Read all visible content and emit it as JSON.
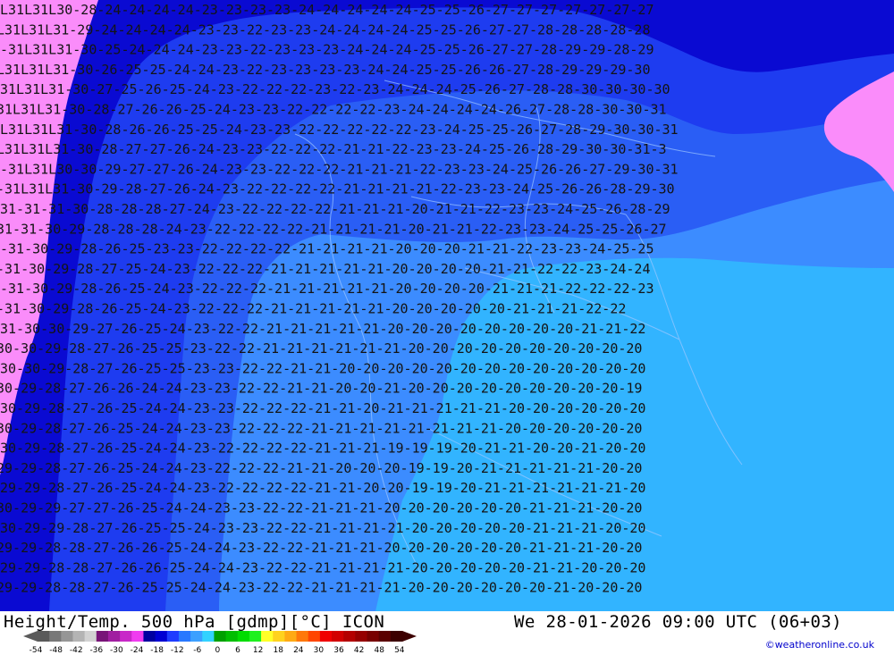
{
  "footer": {
    "title": "Height/Temp. 500 hPa [gdmp][°C] ICON",
    "valid": "We 28-01-2026 09:00 UTC (06+03)",
    "credit": "©weatheronline.co.uk"
  },
  "legend": {
    "labels": [
      "-54",
      "-48",
      "-42",
      "-36",
      "-30",
      "-24",
      "-18",
      "-12",
      "-6",
      "0",
      "6",
      "12",
      "18",
      "24",
      "30",
      "36",
      "42",
      "48",
      "54"
    ],
    "colors": [
      "#5a5a5a",
      "#787878",
      "#969696",
      "#b4b4b4",
      "#d2d2d2",
      "#781478",
      "#a01ea0",
      "#c828c8",
      "#f03cf0",
      "#0000a0",
      "#0000d2",
      "#1e3cff",
      "#2878ff",
      "#3ca0ff",
      "#32d2ff",
      "#00a000",
      "#00be00",
      "#00dc00",
      "#1ef01e",
      "#ffff28",
      "#ffd21e",
      "#ffaa14",
      "#ff780a",
      "#ff4600",
      "#f00000",
      "#d20000",
      "#b40000",
      "#960000",
      "#780000",
      "#5a0000",
      "#3c0000"
    ]
  },
  "map": {
    "zone_colors": {
      "magenta": "#fa8cfa",
      "dark_blue": "#0a0ad2",
      "mid_blue": "#1e3cf0",
      "blue": "#2a5ef5",
      "light_blue": "#3c8cff",
      "cyan_blue": "#32b4ff"
    },
    "label_rows": [
      "L31L31L30-28-24-24-24-24-23-23-23-23-24-24-24-24-24-25-25-26-27-27-27-27-27-27-27",
      "L31L31L31-29-24-24-24-24-23-23-22-23-23-24-24-24-24-25-25-26-27-27-28-28-28-28-28",
      "-31L31L31-30-25-24-24-24-23-23-22-23-23-23-24-24-24-25-25-26-27-27-28-29-29-28-29",
      "L31L31L31-30-26-25-25-24-24-23-22-23-23-23-23-24-24-25-25-26-26-27-28-29-29-29-30",
      "31L31L31-30-27-25-26-25-24-23-22-22-22-23-22-23-24-24-24-25-26-27-28-28-30-30-30-30",
      "31L31L31-30-28-27-26-26-25-24-23-23-22-22-22-22-23-24-24-24-24-26-27-28-28-30-30-31",
      "L31L31L31-30-28-26-26-25-25-24-23-23-22-22-22-22-22-23-24-25-25-26-27-28-29-30-30-31",
      "L31L31L31-30-28-27-27-26-24-23-23-22-22-22-21-21-22-23-23-24-25-26-28-29-30-30-31-3",
      "-31L31L30-30-29-27-27-26-24-23-23-22-22-22-21-21-21-22-23-23-24-25-26-26-27-29-30-31",
      "-31L31L31-30-29-28-27-26-24-23-22-22-22-22-21-21-21-21-22-23-23-24-25-26-26-28-29-30",
      "31-31-31-30-28-28-28-27-24-23-22-22-22-22-21-21-21-20-21-21-22-23-23-24-25-26-28-29",
      "31-31-30-29-28-28-28-24-23-22-22-22-22-21-21-21-21-20-21-21-22-23-23-24-25-25-26-27",
      "-31-30-29-28-26-25-23-23-22-22-22-22-21-21-21-21-20-20-20-21-21-22-23-23-24-25-25",
      "-31-30-29-28-27-25-24-23-22-22-22-21-21-21-21-21-20-20-20-20-21-21-22-22-23-24-24",
      "-31-30-29-28-26-25-24-23-22-22-22-21-21-21-21-21-20-20-20-20-21-21-21-22-22-22-23",
      "-31-30-29-28-26-25-24-23-22-22-22-21-21-21-21-21-20-20-20-20-20-21-21-21-22-22",
      "31-30-30-29-27-26-25-24-23-22-22-21-21-21-21-21-20-20-20-20-20-20-20-20-21-21-22",
      "30-30-29-28-27-26-25-25-23-22-22-21-21-21-21-21-21-20-20-20-20-20-20-20-20-20-20",
      "30-30-29-28-27-26-25-25-23-23-22-22-21-21-20-20-20-20-20-20-20-20-20-20-20-20-20",
      "30-29-28-27-26-26-24-24-23-23-22-22-21-21-20-20-21-20-20-20-20-20-20-20-20-20-19",
      "30-29-28-27-26-25-24-24-23-23-22-22-22-21-21-20-21-21-21-21-21-20-20-20-20-20-20",
      "30-29-28-27-26-25-24-24-23-23-22-22-22-21-21-21-21-21-21-21-21-20-20-20-20-20-20",
      "30-29-28-27-26-25-24-24-23-22-22-22-22-21-21-21-19-19-19-20-21-21-20-20-21-20-20",
      "29-29-28-27-26-25-24-24-23-22-22-22-21-21-20-20-20-19-19-20-21-21-21-21-21-20-20",
      "29-29-28-27-26-25-24-24-23-22-22-22-22-21-21-20-20-19-19-20-21-21-21-21-21-21-20",
      "30-29-29-27-27-26-25-24-24-23-23-22-22-21-21-21-20-20-20-20-20-20-21-21-21-20-20",
      "30-29-29-28-27-26-25-25-24-23-23-22-22-21-21-21-21-20-20-20-20-20-21-21-21-20-20",
      "29-29-28-28-27-26-26-25-24-24-23-22-22-21-21-21-20-20-20-20-20-20-21-21-21-20-20",
      "29-29-28-28-27-26-26-25-24-24-23-22-22-21-21-21-21-20-20-20-20-20-21-21-20-20-20",
      "29-29-28-28-27-26-25-25-24-24-23-22-22-21-21-21-21-20-20-20-20-20-20-21-20-20-20"
    ]
  }
}
